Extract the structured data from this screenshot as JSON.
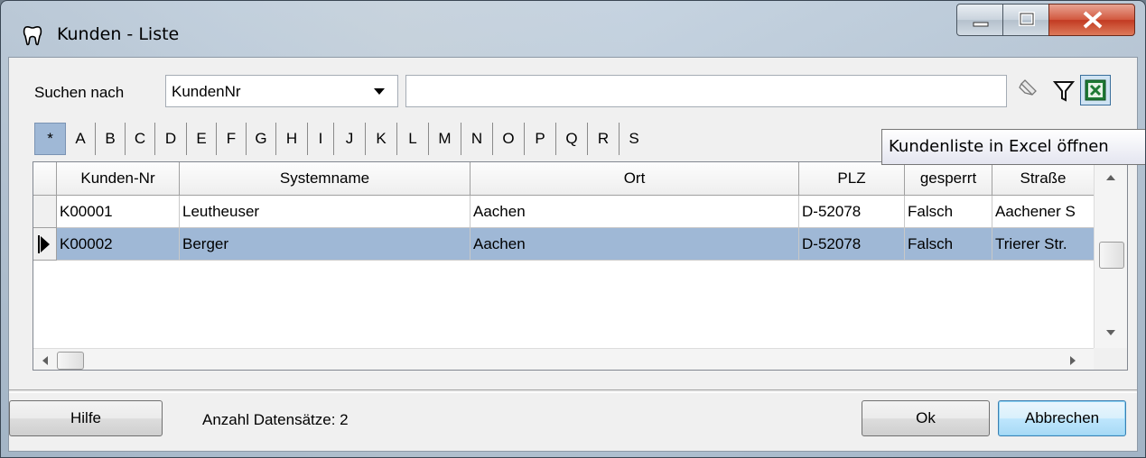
{
  "window": {
    "title": "Kunden - Liste"
  },
  "search": {
    "label": "Suchen nach",
    "field_value": "KundenNr",
    "text_value": "",
    "text_placeholder": ""
  },
  "toolbar": {
    "excel_tooltip": "Kundenliste in Excel öffnen"
  },
  "alphabet": [
    "*",
    "A",
    "B",
    "C",
    "D",
    "E",
    "F",
    "G",
    "H",
    "I",
    "J",
    "K",
    "L",
    "M",
    "N",
    "O",
    "P",
    "Q",
    "R",
    "S"
  ],
  "alphabet_active": "*",
  "table": {
    "columns": [
      "Kunden-Nr",
      "Systemname",
      "Ort",
      "PLZ",
      "gesperrt",
      "Straße"
    ],
    "rows": [
      {
        "kunden_nr": "K00001",
        "systemname": "Leutheuser",
        "ort": "Aachen",
        "plz": "D-52078",
        "gesperrt": "Falsch",
        "strasse": "Aachener S",
        "selected": false
      },
      {
        "kunden_nr": "K00002",
        "systemname": "Berger",
        "ort": "Aachen",
        "plz": "D-52078",
        "gesperrt": "Falsch",
        "strasse": "Trierer Str.",
        "selected": true
      }
    ]
  },
  "footer": {
    "help_label": "Hilfe",
    "count_label": "Anzahl Datensätze: 2",
    "ok_label": "Ok",
    "cancel_label": "Abbrechen"
  },
  "colors": {
    "selection": "#9fb8d6",
    "close_button": "#c23a22",
    "excel_green": "#1f7a35"
  }
}
